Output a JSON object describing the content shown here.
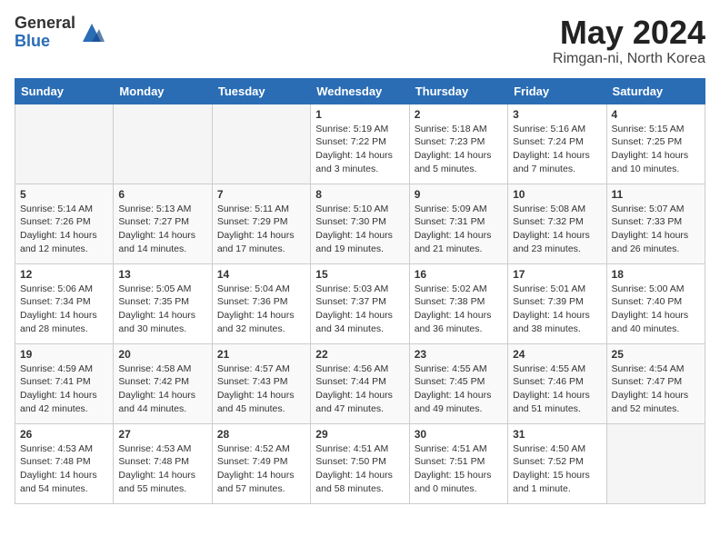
{
  "logo": {
    "general": "General",
    "blue": "Blue"
  },
  "title": "May 2024",
  "location": "Rimgan-ni, North Korea",
  "weekdays": [
    "Sunday",
    "Monday",
    "Tuesday",
    "Wednesday",
    "Thursday",
    "Friday",
    "Saturday"
  ],
  "weeks": [
    [
      {
        "day": "",
        "sunrise": "",
        "sunset": "",
        "daylight": ""
      },
      {
        "day": "",
        "sunrise": "",
        "sunset": "",
        "daylight": ""
      },
      {
        "day": "",
        "sunrise": "",
        "sunset": "",
        "daylight": ""
      },
      {
        "day": "1",
        "sunrise": "Sunrise: 5:19 AM",
        "sunset": "Sunset: 7:22 PM",
        "daylight": "Daylight: 14 hours and 3 minutes."
      },
      {
        "day": "2",
        "sunrise": "Sunrise: 5:18 AM",
        "sunset": "Sunset: 7:23 PM",
        "daylight": "Daylight: 14 hours and 5 minutes."
      },
      {
        "day": "3",
        "sunrise": "Sunrise: 5:16 AM",
        "sunset": "Sunset: 7:24 PM",
        "daylight": "Daylight: 14 hours and 7 minutes."
      },
      {
        "day": "4",
        "sunrise": "Sunrise: 5:15 AM",
        "sunset": "Sunset: 7:25 PM",
        "daylight": "Daylight: 14 hours and 10 minutes."
      }
    ],
    [
      {
        "day": "5",
        "sunrise": "Sunrise: 5:14 AM",
        "sunset": "Sunset: 7:26 PM",
        "daylight": "Daylight: 14 hours and 12 minutes."
      },
      {
        "day": "6",
        "sunrise": "Sunrise: 5:13 AM",
        "sunset": "Sunset: 7:27 PM",
        "daylight": "Daylight: 14 hours and 14 minutes."
      },
      {
        "day": "7",
        "sunrise": "Sunrise: 5:11 AM",
        "sunset": "Sunset: 7:29 PM",
        "daylight": "Daylight: 14 hours and 17 minutes."
      },
      {
        "day": "8",
        "sunrise": "Sunrise: 5:10 AM",
        "sunset": "Sunset: 7:30 PM",
        "daylight": "Daylight: 14 hours and 19 minutes."
      },
      {
        "day": "9",
        "sunrise": "Sunrise: 5:09 AM",
        "sunset": "Sunset: 7:31 PM",
        "daylight": "Daylight: 14 hours and 21 minutes."
      },
      {
        "day": "10",
        "sunrise": "Sunrise: 5:08 AM",
        "sunset": "Sunset: 7:32 PM",
        "daylight": "Daylight: 14 hours and 23 minutes."
      },
      {
        "day": "11",
        "sunrise": "Sunrise: 5:07 AM",
        "sunset": "Sunset: 7:33 PM",
        "daylight": "Daylight: 14 hours and 26 minutes."
      }
    ],
    [
      {
        "day": "12",
        "sunrise": "Sunrise: 5:06 AM",
        "sunset": "Sunset: 7:34 PM",
        "daylight": "Daylight: 14 hours and 28 minutes."
      },
      {
        "day": "13",
        "sunrise": "Sunrise: 5:05 AM",
        "sunset": "Sunset: 7:35 PM",
        "daylight": "Daylight: 14 hours and 30 minutes."
      },
      {
        "day": "14",
        "sunrise": "Sunrise: 5:04 AM",
        "sunset": "Sunset: 7:36 PM",
        "daylight": "Daylight: 14 hours and 32 minutes."
      },
      {
        "day": "15",
        "sunrise": "Sunrise: 5:03 AM",
        "sunset": "Sunset: 7:37 PM",
        "daylight": "Daylight: 14 hours and 34 minutes."
      },
      {
        "day": "16",
        "sunrise": "Sunrise: 5:02 AM",
        "sunset": "Sunset: 7:38 PM",
        "daylight": "Daylight: 14 hours and 36 minutes."
      },
      {
        "day": "17",
        "sunrise": "Sunrise: 5:01 AM",
        "sunset": "Sunset: 7:39 PM",
        "daylight": "Daylight: 14 hours and 38 minutes."
      },
      {
        "day": "18",
        "sunrise": "Sunrise: 5:00 AM",
        "sunset": "Sunset: 7:40 PM",
        "daylight": "Daylight: 14 hours and 40 minutes."
      }
    ],
    [
      {
        "day": "19",
        "sunrise": "Sunrise: 4:59 AM",
        "sunset": "Sunset: 7:41 PM",
        "daylight": "Daylight: 14 hours and 42 minutes."
      },
      {
        "day": "20",
        "sunrise": "Sunrise: 4:58 AM",
        "sunset": "Sunset: 7:42 PM",
        "daylight": "Daylight: 14 hours and 44 minutes."
      },
      {
        "day": "21",
        "sunrise": "Sunrise: 4:57 AM",
        "sunset": "Sunset: 7:43 PM",
        "daylight": "Daylight: 14 hours and 45 minutes."
      },
      {
        "day": "22",
        "sunrise": "Sunrise: 4:56 AM",
        "sunset": "Sunset: 7:44 PM",
        "daylight": "Daylight: 14 hours and 47 minutes."
      },
      {
        "day": "23",
        "sunrise": "Sunrise: 4:55 AM",
        "sunset": "Sunset: 7:45 PM",
        "daylight": "Daylight: 14 hours and 49 minutes."
      },
      {
        "day": "24",
        "sunrise": "Sunrise: 4:55 AM",
        "sunset": "Sunset: 7:46 PM",
        "daylight": "Daylight: 14 hours and 51 minutes."
      },
      {
        "day": "25",
        "sunrise": "Sunrise: 4:54 AM",
        "sunset": "Sunset: 7:47 PM",
        "daylight": "Daylight: 14 hours and 52 minutes."
      }
    ],
    [
      {
        "day": "26",
        "sunrise": "Sunrise: 4:53 AM",
        "sunset": "Sunset: 7:48 PM",
        "daylight": "Daylight: 14 hours and 54 minutes."
      },
      {
        "day": "27",
        "sunrise": "Sunrise: 4:53 AM",
        "sunset": "Sunset: 7:48 PM",
        "daylight": "Daylight: 14 hours and 55 minutes."
      },
      {
        "day": "28",
        "sunrise": "Sunrise: 4:52 AM",
        "sunset": "Sunset: 7:49 PM",
        "daylight": "Daylight: 14 hours and 57 minutes."
      },
      {
        "day": "29",
        "sunrise": "Sunrise: 4:51 AM",
        "sunset": "Sunset: 7:50 PM",
        "daylight": "Daylight: 14 hours and 58 minutes."
      },
      {
        "day": "30",
        "sunrise": "Sunrise: 4:51 AM",
        "sunset": "Sunset: 7:51 PM",
        "daylight": "Daylight: 15 hours and 0 minutes."
      },
      {
        "day": "31",
        "sunrise": "Sunrise: 4:50 AM",
        "sunset": "Sunset: 7:52 PM",
        "daylight": "Daylight: 15 hours and 1 minute."
      },
      {
        "day": "",
        "sunrise": "",
        "sunset": "",
        "daylight": ""
      }
    ]
  ]
}
